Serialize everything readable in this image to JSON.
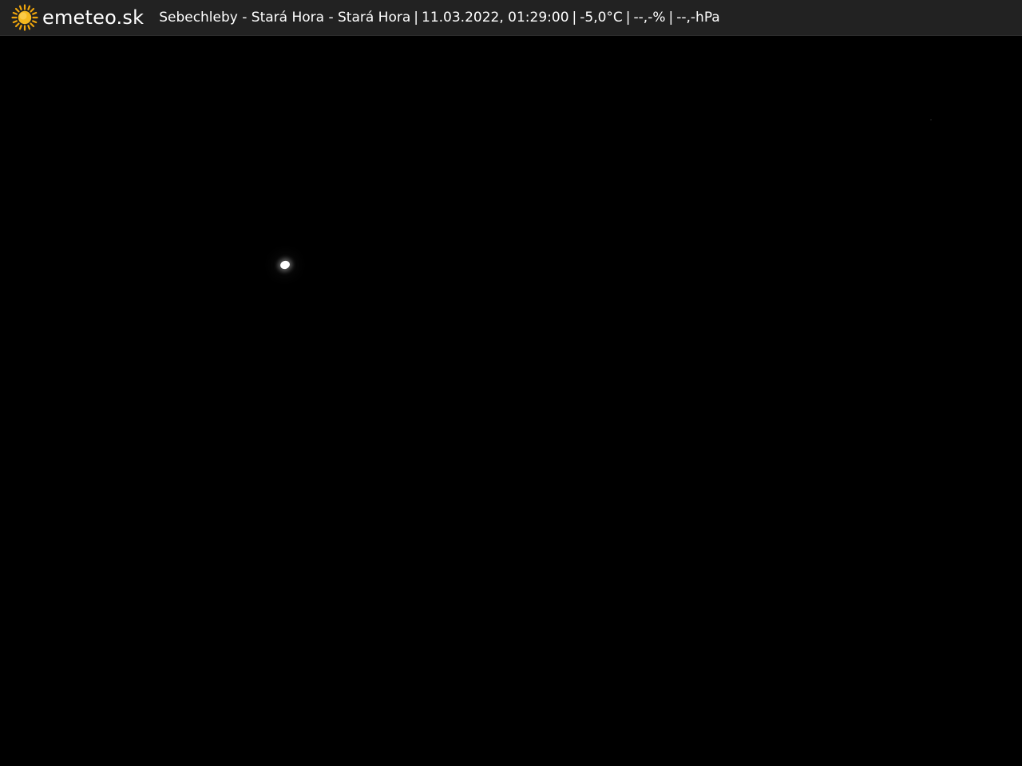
{
  "header": {
    "brand_icon": "sun-icon",
    "brand_name": "emeteo.sk",
    "location": "Sebechleby - Stará Hora - Stará Hora",
    "datetime": "11.03.2022, 01:29:00",
    "temperature": "-5,0°C",
    "humidity": "--,-%",
    "pressure": "--,-hPa",
    "separator": "|"
  },
  "colors": {
    "bar_background": "#222222",
    "sun_core": "#f5b81f",
    "sun_rays": "#f0a60c",
    "text": "#ffffff",
    "feed_background": "#000000"
  }
}
